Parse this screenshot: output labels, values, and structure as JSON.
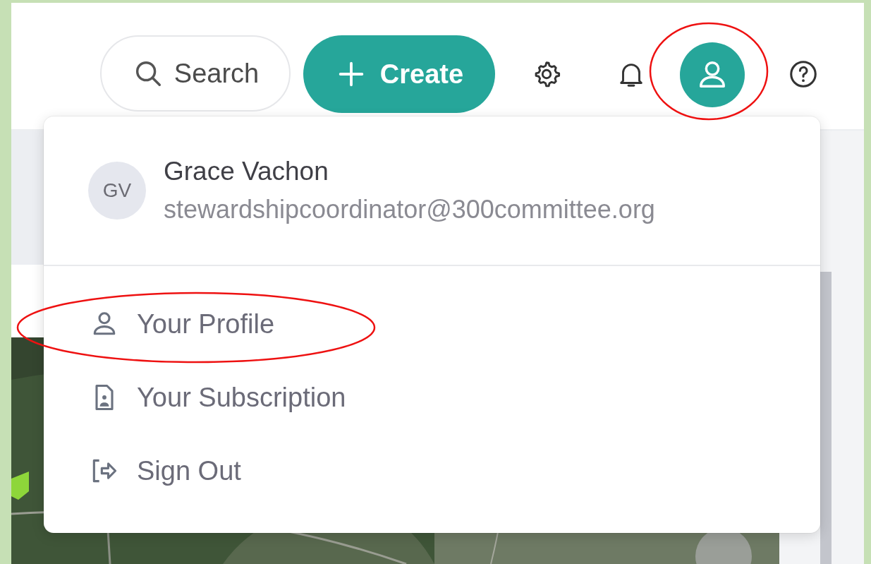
{
  "header": {
    "search_label": "Search",
    "create_label": "Create",
    "account_button": {
      "expanded": true
    }
  },
  "user_menu": {
    "initials": "GV",
    "name": "Grace Vachon",
    "email": "stewardshipcoordinator@300committee.org",
    "items": [
      {
        "kind": "profile",
        "label": "Your Profile"
      },
      {
        "kind": "subscription",
        "label": "Your Subscription"
      },
      {
        "kind": "sign_out",
        "label": "Sign Out"
      }
    ]
  }
}
